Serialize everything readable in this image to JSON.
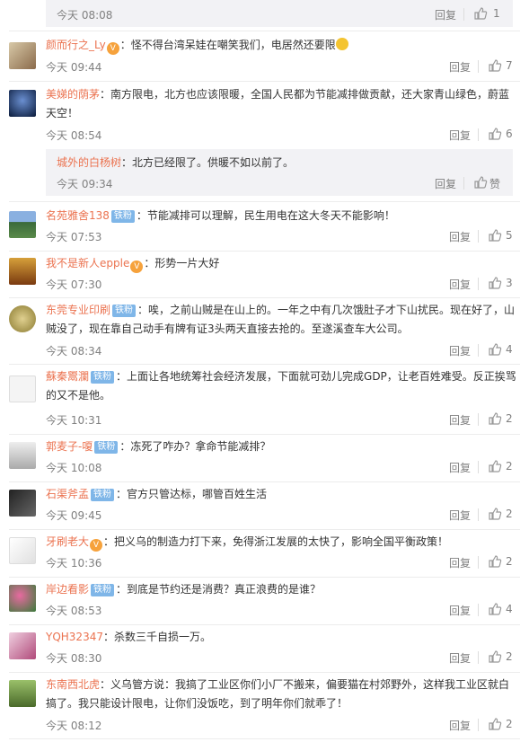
{
  "comments": [
    {
      "time": "今天 08:08",
      "reply": "回复",
      "likes": "1",
      "is_sub": true
    },
    {
      "user": "颜而行之_Ly",
      "text": "：怪不得台湾呆娃在嘲笑我们，电居然还要限",
      "time": "今天 09:44",
      "reply": "回复",
      "likes": "7"
    },
    {
      "user": "美娣的荫茅",
      "text": "：南方限电，北方也应该限暖，全国人民都为节能减排做贡献，还大家青山绿色，蔚蓝天空！",
      "time": "今天 08:54",
      "reply": "回复",
      "likes": "6"
    },
    {
      "user": "城外的白杨树",
      "text": "：北方已经限了。供暖不如以前了。",
      "time": "今天 09:34",
      "reply": "回复",
      "likes": "赞",
      "is_sub": true
    },
    {
      "user": "名苑雅舍138",
      "badge": "铁粉",
      "text": "：节能减排可以理解，民生用电在这大冬天不能影响！",
      "time": "今天 07:53",
      "reply": "回复",
      "likes": "5"
    },
    {
      "user": "我不是新人epple",
      "text": "：形势一片大好",
      "time": "今天 07:30",
      "reply": "回复",
      "likes": "3"
    },
    {
      "user": "东莞专业印刷",
      "badge": "铁粉",
      "text": "：唉，之前山贼是在山上的。一年之中有几次饿肚子才下山扰民。现在好了，山贼没了，现在靠自己动手有牌有证3头两天直接去抢的。至遂溪查车大公司。",
      "time": "今天 08:34",
      "reply": "回复",
      "likes": "4"
    },
    {
      "user": "蘇秦鬻瀾",
      "badge": "铁粉",
      "text": "：上面让各地统筹社会经济发展，下面就可劲儿完成GDP，让老百姓难受。反正挨骂的又不是他。",
      "time": "今天 10:31",
      "reply": "回复",
      "likes": "2"
    },
    {
      "user": "郭麦子-嗄",
      "badge": "铁粉",
      "text": "：冻死了咋办？拿命节能减排？",
      "time": "今天 10:08",
      "reply": "回复",
      "likes": "2"
    },
    {
      "user": "石渠斧孟",
      "badge": "铁粉",
      "text": "：官方只管达标，哪管百姓生活",
      "time": "今天 09:45",
      "reply": "回复",
      "likes": "2"
    },
    {
      "user": "牙刷老大",
      "text": "：把义乌的制造力打下来，免得浙江发展的太快了，影响全国平衡政策！",
      "time": "今天 10:36",
      "reply": "回复",
      "likes": "2"
    },
    {
      "user": "岸边看影",
      "badge": "铁粉",
      "text": "：到底是节约还是消费？真正浪费的是谁？",
      "time": "今天 08:53",
      "reply": "回复",
      "likes": "4"
    },
    {
      "user": "YQH32347",
      "text": "：杀数三千自损一万。",
      "time": "今天 08:30",
      "reply": "回复",
      "likes": "2"
    },
    {
      "user": "东南西北虎",
      "text": "：义乌管方说：我搞了工业区你们小厂不搬来，偏要猫在村郊野外，这样我工业区就白搞了。我只能设计限电，让你们没饭吃，到了明年你们就乖了！",
      "time": "今天 08:12",
      "reply": "回复",
      "likes": "2"
    }
  ],
  "colors": {
    "name": "#eb7350",
    "badge": "#7fb6e8",
    "muted": "#808080",
    "subbox": "#f2f2f5"
  }
}
